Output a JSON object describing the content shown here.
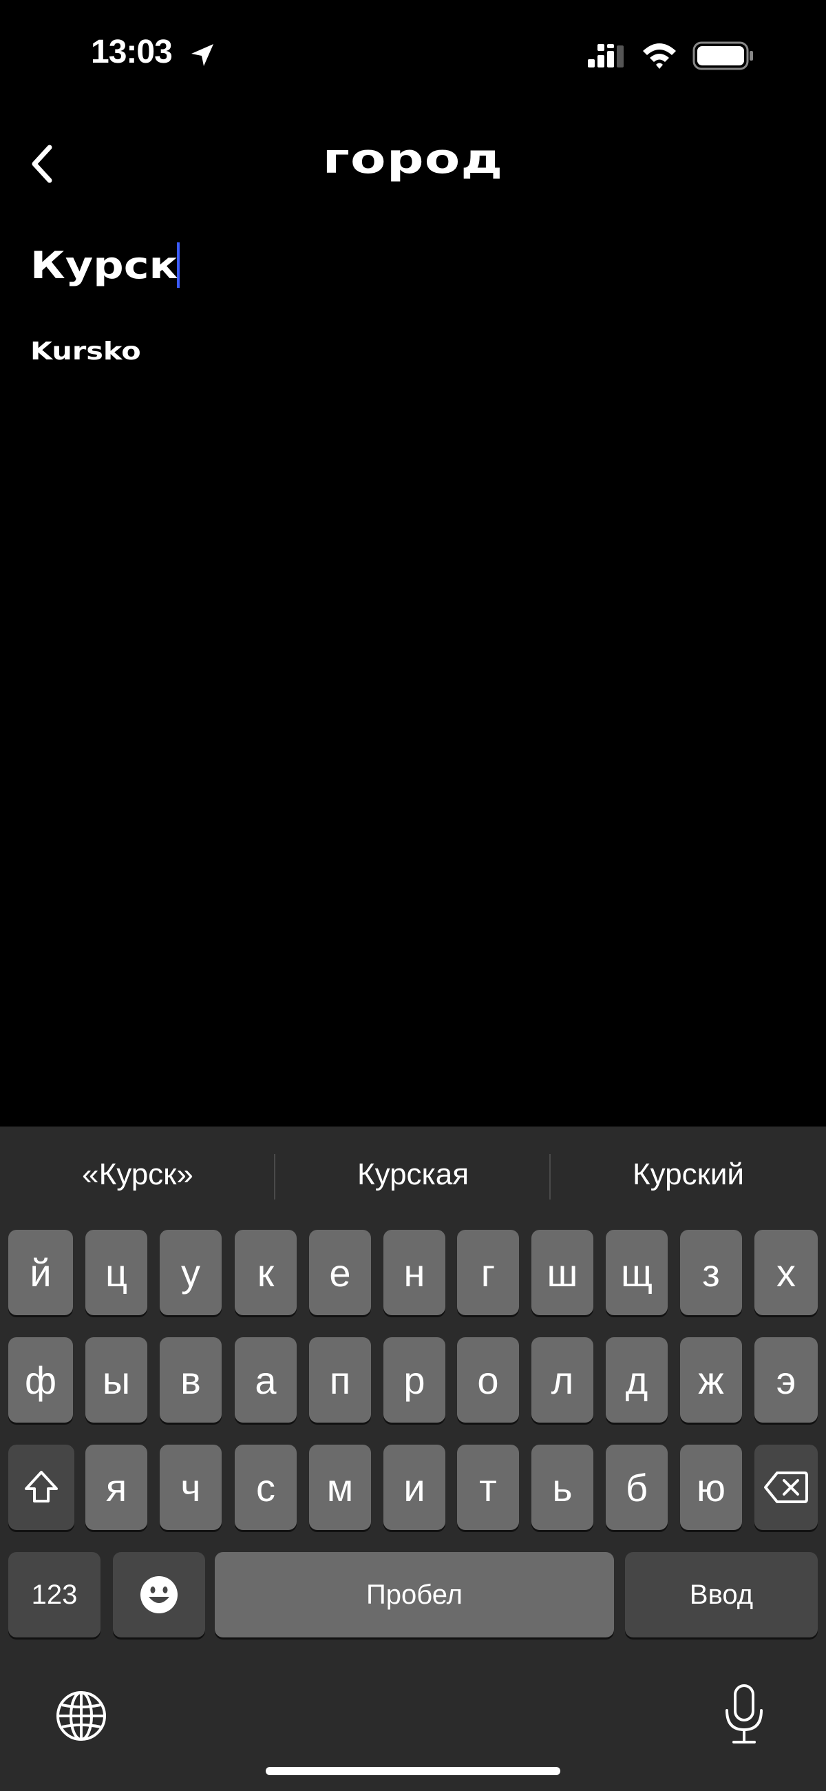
{
  "status_bar": {
    "time": "13:03"
  },
  "header": {
    "title": "город"
  },
  "search": {
    "value": "Курск"
  },
  "suggestions": [
    "Kursko"
  ],
  "keyboard": {
    "predictions": [
      "«Курск»",
      "Курская",
      "Курский"
    ],
    "row1": [
      "й",
      "ц",
      "у",
      "к",
      "е",
      "н",
      "г",
      "ш",
      "щ",
      "з",
      "х"
    ],
    "row2": [
      "ф",
      "ы",
      "в",
      "а",
      "п",
      "р",
      "о",
      "л",
      "д",
      "ж",
      "э"
    ],
    "row3": [
      "я",
      "ч",
      "с",
      "м",
      "и",
      "т",
      "ь",
      "б",
      "ю"
    ],
    "numbers_label": "123",
    "space_label": "Пробел",
    "return_label": "Ввод"
  },
  "colors": {
    "background": "#000000",
    "caret": "#3b5bff",
    "keyboard_bg": "#2b2b2b",
    "key": "#6b6b6b",
    "key_dark": "#464646"
  }
}
